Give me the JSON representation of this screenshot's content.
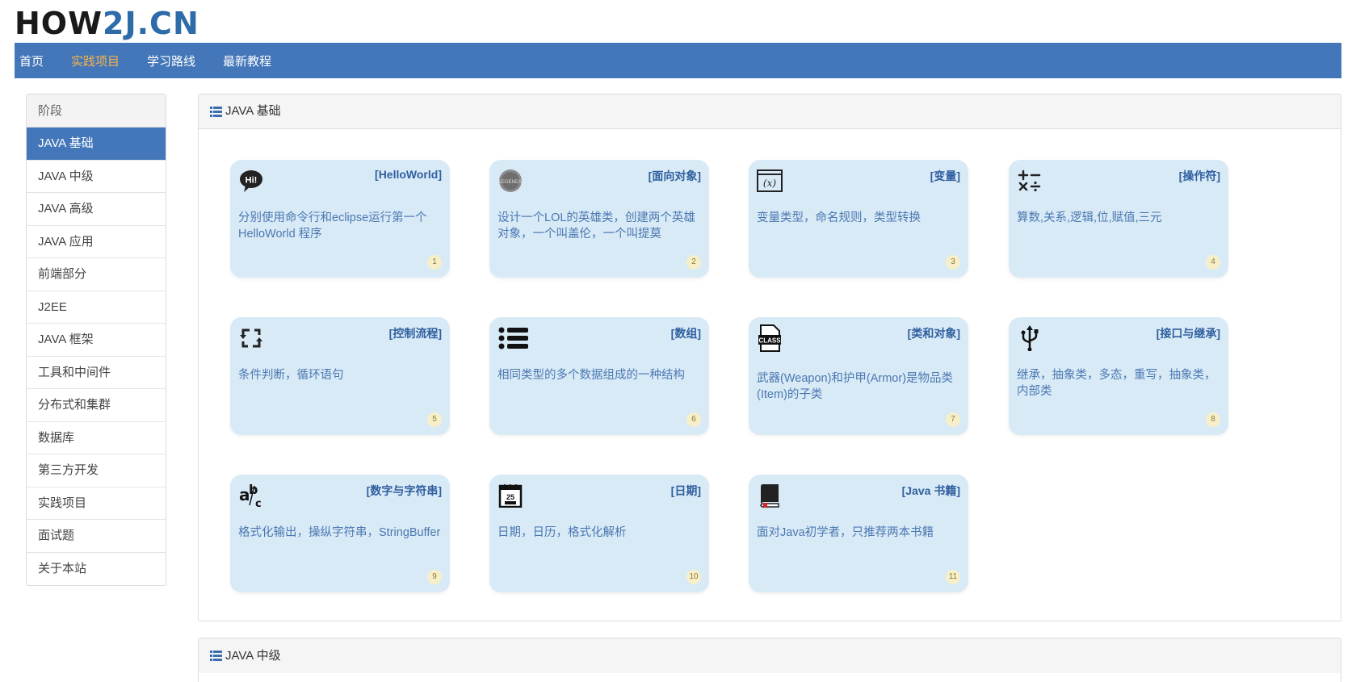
{
  "logo": {
    "part1": "HOW",
    "part2": "2J",
    "part3": ".CN"
  },
  "topnav": {
    "items": [
      {
        "label": "首页"
      },
      {
        "label": "实践项目"
      },
      {
        "label": "学习路线"
      },
      {
        "label": "最新教程"
      }
    ],
    "active_color": "#f6b24a",
    "bg_color": "#4477b9"
  },
  "sidebar": {
    "header": "阶段",
    "items": [
      {
        "label": "JAVA 基础"
      },
      {
        "label": "JAVA 中级"
      },
      {
        "label": "JAVA 高级"
      },
      {
        "label": "JAVA 应用"
      },
      {
        "label": "前端部分"
      },
      {
        "label": "J2EE"
      },
      {
        "label": "JAVA 框架"
      },
      {
        "label": "工具和中间件"
      },
      {
        "label": "分布式和集群"
      },
      {
        "label": "数据库"
      },
      {
        "label": "第三方开发"
      },
      {
        "label": "实践项目"
      },
      {
        "label": "面试题"
      },
      {
        "label": "关于本站"
      }
    ]
  },
  "main": {
    "section_title": "JAVA 基础",
    "next_section_title": "JAVA 中级",
    "cards": [
      {
        "title": "[HelloWorld]",
        "desc": "分别使用命令行和eclipse运行第一个HelloWorld 程序",
        "num": "1",
        "icon": "hi-speech-icon"
      },
      {
        "title": "[面向对象]",
        "desc": "设计一个LOL的英雄类，创建两个英雄对象，一个叫盖伦，一个叫提莫",
        "num": "2",
        "icon": "lol-logo-icon"
      },
      {
        "title": "[变量]",
        "desc": "变量类型，命名规则，类型转换",
        "num": "3",
        "icon": "variable-x-icon"
      },
      {
        "title": "[操作符]",
        "desc": "算数,关系,逻辑,位,赋值,三元",
        "num": "4",
        "icon": "operators-icon"
      },
      {
        "title": "[控制流程]",
        "desc": "条件判断，循环语句",
        "num": "5",
        "icon": "loop-arrows-icon"
      },
      {
        "title": "[数组]",
        "desc": "相同类型的多个数据组成的一种结构",
        "num": "6",
        "icon": "list-icon"
      },
      {
        "title": "[类和对象]",
        "desc": "武器(Weapon)和护甲(Armor)是物品类(Item)的子类",
        "num": "7",
        "icon": "class-file-icon"
      },
      {
        "title": "[接口与继承]",
        "desc": "继承，抽象类，多态，重写，抽象类，内部类",
        "num": "8",
        "icon": "usb-fork-icon"
      },
      {
        "title": "[数字与字符串]",
        "desc": "格式化输出，操纵字符串，StringBuffer",
        "num": "9",
        "icon": "abc-letters-icon"
      },
      {
        "title": "[日期]",
        "desc": "日期，日历，格式化解析",
        "num": "10",
        "icon": "calendar-icon"
      },
      {
        "title": "[Java 书籍]",
        "desc": "面对Java初学者，只推荐两本书籍",
        "num": "11",
        "icon": "book-icon"
      }
    ]
  }
}
